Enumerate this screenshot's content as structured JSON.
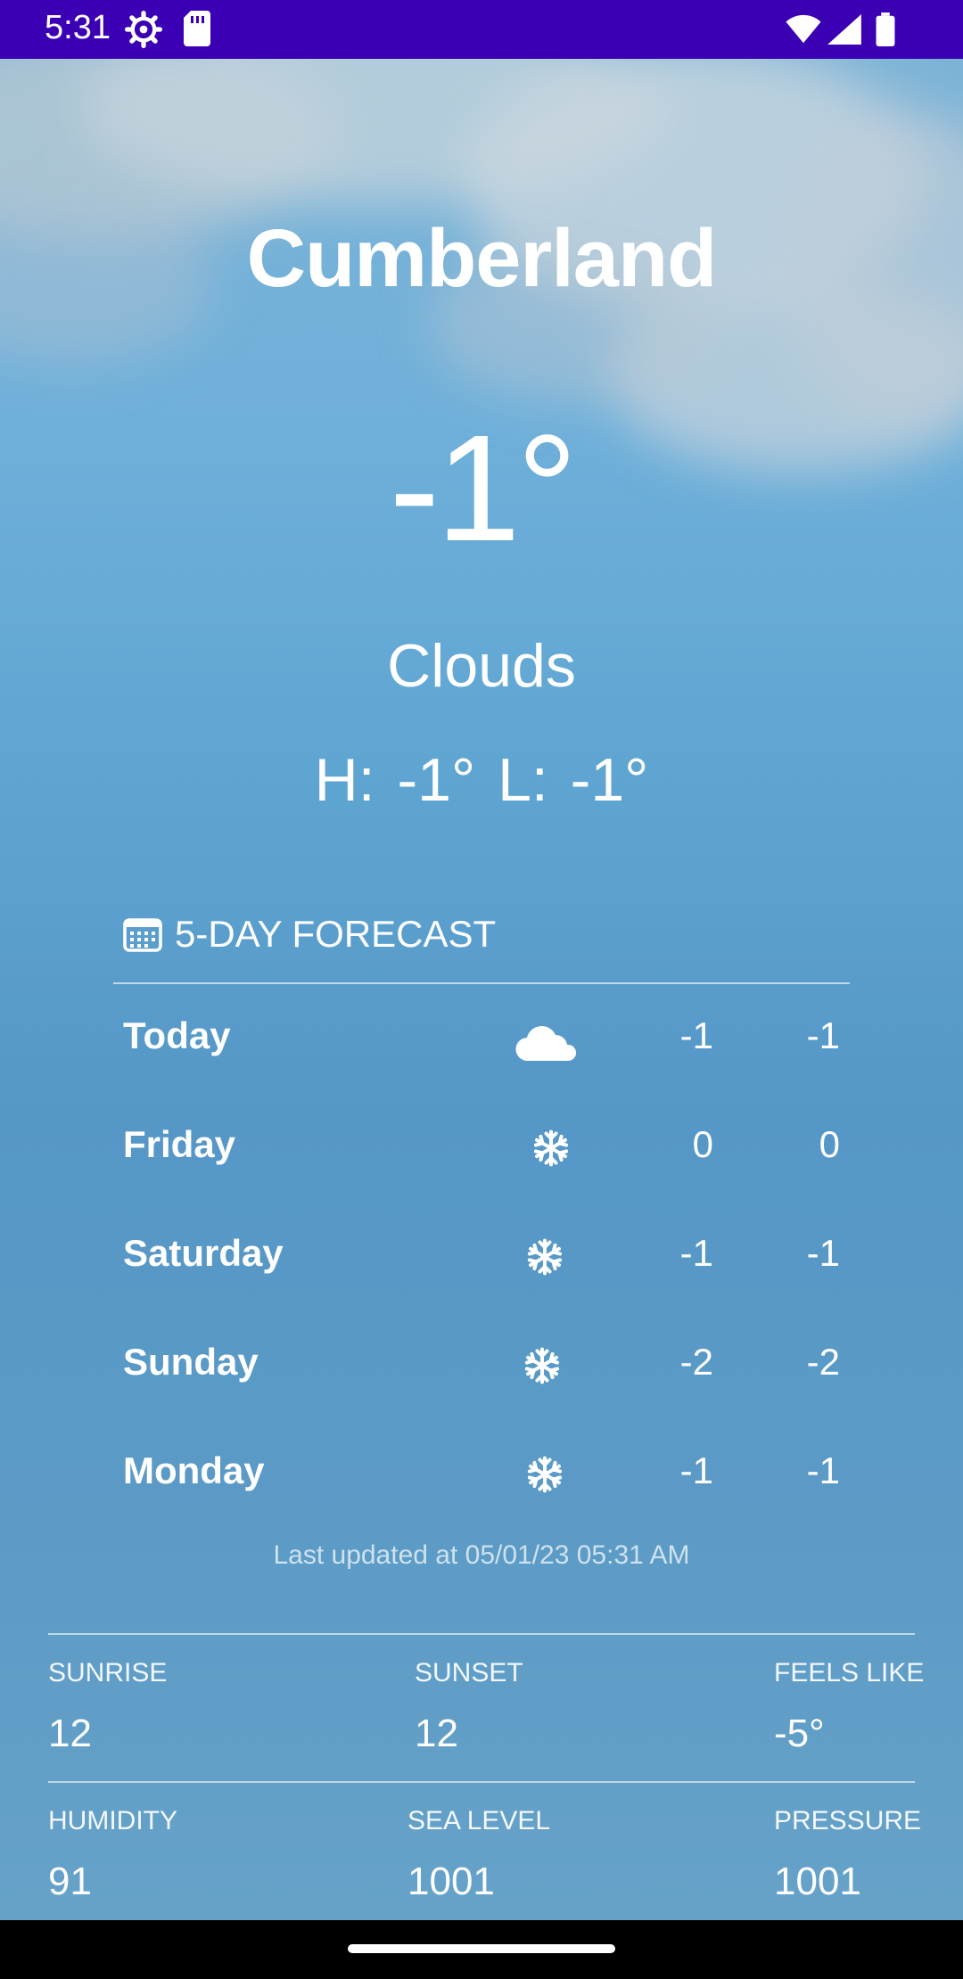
{
  "status_bar": {
    "time": "5:31"
  },
  "weather": {
    "city": "Cumberland",
    "temperature": "-1°",
    "condition": "Clouds",
    "high_low": "H: -1°  L: -1°"
  },
  "forecast": {
    "title": "5-DAY FORECAST",
    "days": [
      {
        "day": "Today",
        "icon": "cloud-icon",
        "high": "-1",
        "low": "-1"
      },
      {
        "day": "Friday",
        "icon": "snowflake-icon",
        "high": "0",
        "low": "0"
      },
      {
        "day": "Saturday",
        "icon": "snowflake-icon",
        "high": "-1",
        "low": "-1"
      },
      {
        "day": "Sunday",
        "icon": "snowflake-icon",
        "high": "-2",
        "low": "-2"
      },
      {
        "day": "Monday",
        "icon": "snowflake-icon",
        "high": "-1",
        "low": "-1"
      }
    ],
    "last_updated": "Last updated at 05/01/23 05:31 AM"
  },
  "details": {
    "sunrise_label": "SUNRISE",
    "sunrise_value": "12",
    "sunset_label": "SUNSET",
    "sunset_value": "12",
    "feels_like_label": "FEELS LIKE",
    "feels_like_value": "-5°",
    "humidity_label": "HUMIDITY",
    "humidity_value": "91",
    "sea_level_label": "SEA LEVEL",
    "sea_level_value": "1001",
    "pressure_label": "PRESSURE",
    "pressure_value": "1001"
  },
  "colors": {
    "status_bar": "#3b00b4",
    "sky": "#5fa5d2"
  }
}
